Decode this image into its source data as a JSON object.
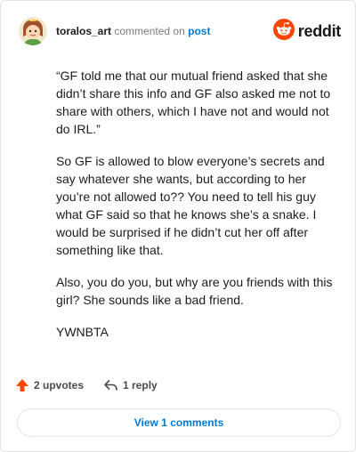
{
  "comment": {
    "author": "toralos_art",
    "action_text": "commented on",
    "post_link_text": "post",
    "paragraphs": [
      "“GF told me that our mutual friend asked that she didn’t share this info and GF also asked me not to share with others, which I have not and would not do IRL.”",
      "So GF is allowed to blow everyone’s secrets and say whatever she wants, but according to her you’re not allowed to?? You need to tell his guy what GF said so that he knows she’s a snake. I would be surprised if he didn’t cut her off after something like that.",
      "Also, you do you, but why are you friends with this girl? She sounds like a bad friend.",
      "YWNBTA"
    ]
  },
  "brand": {
    "wordmark": "reddit",
    "logo_icon": "reddit-snoo-icon",
    "accent_color": "#ff4500"
  },
  "actions": {
    "upvotes_label": "2 upvotes",
    "upvote_icon": "upvote-arrow-icon",
    "upvote_color": "#ff4500",
    "reply_label": "1 reply",
    "reply_icon": "reply-arrow-icon"
  },
  "footer": {
    "view_comments_label": "View 1 comments",
    "link_color": "#0079d3"
  }
}
